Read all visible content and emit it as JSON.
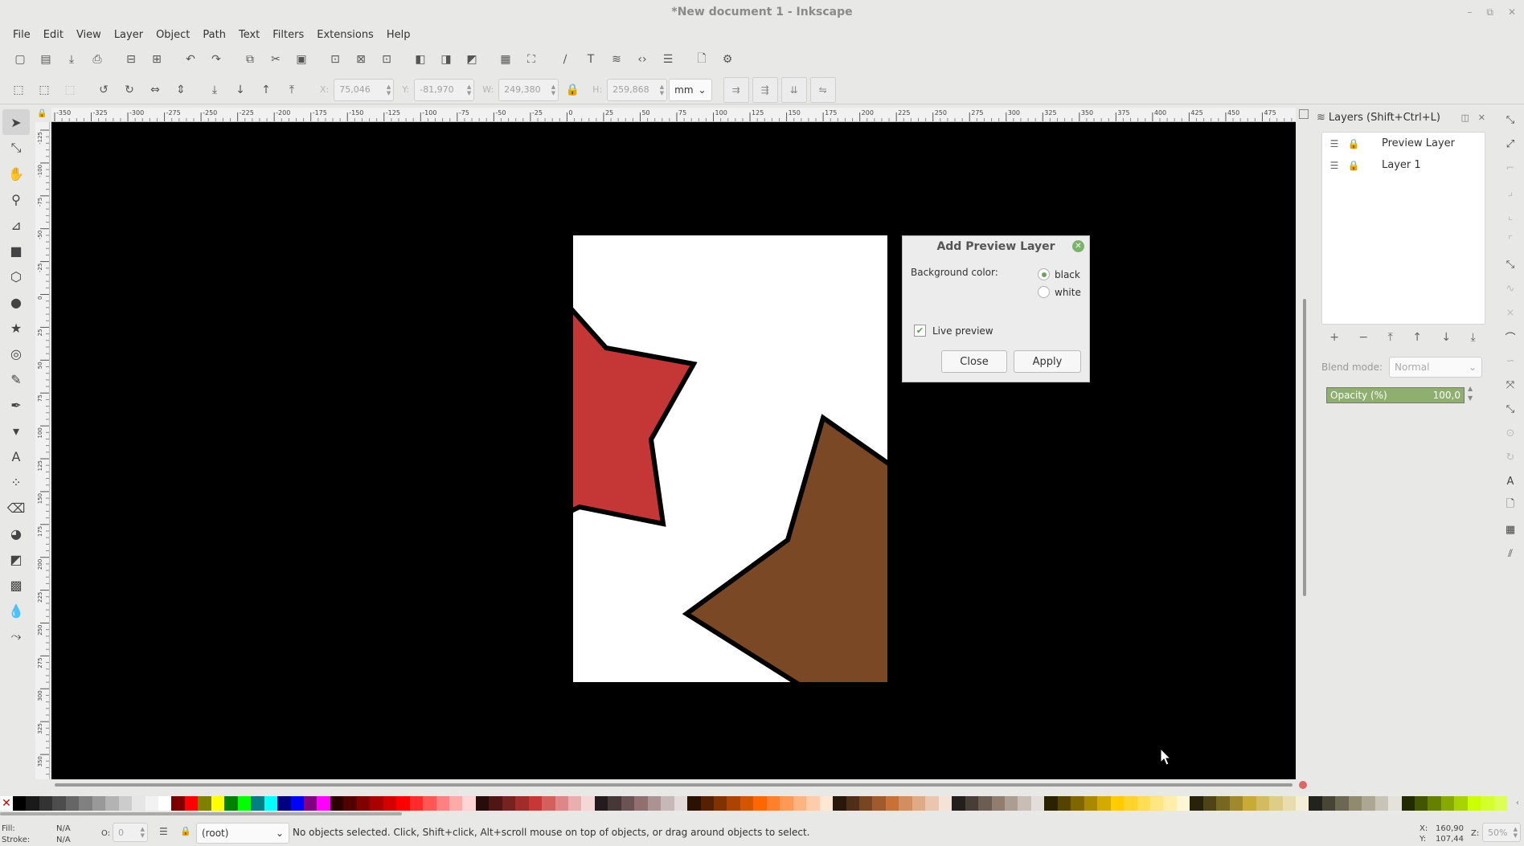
{
  "window": {
    "title": "*New document 1 - Inkscape",
    "controls": [
      "–",
      "⧉",
      "✕"
    ]
  },
  "menu": [
    "File",
    "Edit",
    "View",
    "Layer",
    "Object",
    "Path",
    "Text",
    "Filters",
    "Extensions",
    "Help"
  ],
  "commands_icons": [
    "new-icon",
    "open-icon",
    "save-icon",
    "print-icon",
    "import-icon",
    "export-icon",
    "undo-icon",
    "redo-icon",
    "copy-icon",
    "cut-icon",
    "paste-icon",
    "zoom-selection-icon",
    "zoom-drawing-icon",
    "zoom-page-icon",
    "duplicate-icon",
    "clone-icon",
    "unlink-icon",
    "group-icon",
    "ungroup-icon",
    "node-editor-icon",
    "text-icon",
    "layers-icon",
    "xml-editor-icon",
    "align-icon",
    "document-properties-icon",
    "preferences-icon"
  ],
  "tool_controls": {
    "x_label": "X:",
    "x_value": "75,046",
    "y_label": "Y:",
    "y_value": "-81,970",
    "w_label": "W:",
    "w_value": "249,380",
    "h_label": "H:",
    "h_value": "259,868",
    "unit": "mm"
  },
  "ruler_top_labels": [
    "-350",
    "-325",
    "-300",
    "-275",
    "-250",
    "-225",
    "-200",
    "-175",
    "-150",
    "-125",
    "-100",
    "-75",
    "-50",
    "-25",
    "0",
    "25",
    "50",
    "75",
    "100",
    "125",
    "150",
    "175",
    "200",
    "225",
    "250",
    "275",
    "300",
    "325",
    "350",
    "375",
    "400",
    "425",
    "450",
    "475"
  ],
  "ruler_left_labels": [
    "-125",
    "-100",
    "-75",
    "-50",
    "-25",
    "0",
    "25",
    "50",
    "75",
    "100",
    "125",
    "150",
    "175",
    "200",
    "225",
    "250",
    "275",
    "300",
    "325",
    "350"
  ],
  "dialog": {
    "title": "Add Preview Layer",
    "bg_label": "Background color:",
    "option_black": "black",
    "option_white": "white",
    "selected": "black",
    "live_preview_label": "Live preview",
    "live_preview_checked": true,
    "close_label": "Close",
    "apply_label": "Apply"
  },
  "layers_panel": {
    "title": "Layers (Shift+Ctrl+L)",
    "layers": [
      {
        "name": "Preview Layer"
      },
      {
        "name": "Layer 1"
      }
    ],
    "blend_label": "Blend mode:",
    "blend_value": "Normal",
    "opacity_label": "Opacity (%)",
    "opacity_value": "100,0"
  },
  "status": {
    "fill_label": "Fill:",
    "fill_value": "N/A",
    "stroke_label": "Stroke:",
    "stroke_value": "N/A",
    "o_label": "O:",
    "o_value": "0",
    "layer_select": "(root)",
    "message": "No objects selected. Click, Shift+click, Alt+scroll mouse on top of objects, or drag around objects to select.",
    "x_label": "X:",
    "x_value": "160,90",
    "y_label": "Y:",
    "y_value": "107,44",
    "z_label": "Z:",
    "zoom": "50%"
  },
  "colors": {
    "red_star": "#c53737",
    "brown_star": "#7b4826",
    "canvas_bg": "#000000",
    "page": "#ffffff",
    "accent_green": "#8eaf6f"
  },
  "palette": [
    "#000000",
    "#1a1a1a",
    "#333333",
    "#4d4d4d",
    "#666666",
    "#808080",
    "#999999",
    "#b3b3b3",
    "#cccccc",
    "#e6e6e6",
    "#f2f2f2",
    "#ffffff",
    "#800000",
    "#ff0000",
    "#808000",
    "#ffff00",
    "#008000",
    "#00ff00",
    "#008080",
    "#00ffff",
    "#000080",
    "#0000ff",
    "#800080",
    "#ff00ff",
    "#2b0000",
    "#550000",
    "#800000",
    "#aa0000",
    "#d40000",
    "#ff0000",
    "#ff2a2a",
    "#ff5555",
    "#ff8080",
    "#ffaaaa",
    "#ffd5d5",
    "#280b0b",
    "#501616",
    "#782121",
    "#a02c2c",
    "#c83737",
    "#d35f5f",
    "#de8787",
    "#e9afaf",
    "#f4d7d7",
    "#241c1c",
    "#483737",
    "#6c5353",
    "#916f6f",
    "#ac9393",
    "#c8b7b7",
    "#e3dbdb",
    "#2b1100",
    "#552200",
    "#803300",
    "#aa4400",
    "#d45500",
    "#ff6600",
    "#ff7f2a",
    "#ff9955",
    "#ffb380",
    "#ffccaa",
    "#ffe6d5",
    "#28170b",
    "#502d16",
    "#784421",
    "#a05a2c",
    "#c87137",
    "#d38d5f",
    "#deaa87",
    "#e9c6af",
    "#f4e3d7",
    "#241f1c",
    "#483e37",
    "#6c5d53",
    "#917c6f",
    "#ac9d93",
    "#c8beb7",
    "#e3dedb",
    "#2b2200",
    "#554400",
    "#806600",
    "#aa8800",
    "#d4aa00",
    "#ffcc00",
    "#ffd42a",
    "#ffdd55",
    "#ffe680",
    "#ffeeaa",
    "#fff6d5",
    "#28220b",
    "#504416",
    "#786721",
    "#a0892c",
    "#c8ab37",
    "#d3bc5f",
    "#decd87",
    "#e9ddaf",
    "#f4eed7",
    "#24221c",
    "#484537",
    "#6c6753",
    "#918a6f",
    "#aca793",
    "#c8c4b7",
    "#e3e2db",
    "#222b00",
    "#445500",
    "#668000",
    "#88aa00",
    "#aad400",
    "#ccff00",
    "#d4ff2a",
    "#ddff55"
  ],
  "tools": [
    "selector-tool-icon",
    "node-tool-icon",
    "tweak-tool-icon",
    "zoom-tool-icon",
    "measure-tool-icon",
    "rect-tool-icon",
    "box3d-tool-icon",
    "ellipse-tool-icon",
    "star-tool-icon",
    "spiral-tool-icon",
    "pencil-tool-icon",
    "pen-tool-icon",
    "calligraphy-tool-icon",
    "text-tool-icon",
    "spray-tool-icon",
    "eraser-tool-icon",
    "bucket-tool-icon",
    "gradient-tool-icon",
    "mesh-tool-icon",
    "dropper-tool-icon",
    "connector-tool-icon"
  ]
}
